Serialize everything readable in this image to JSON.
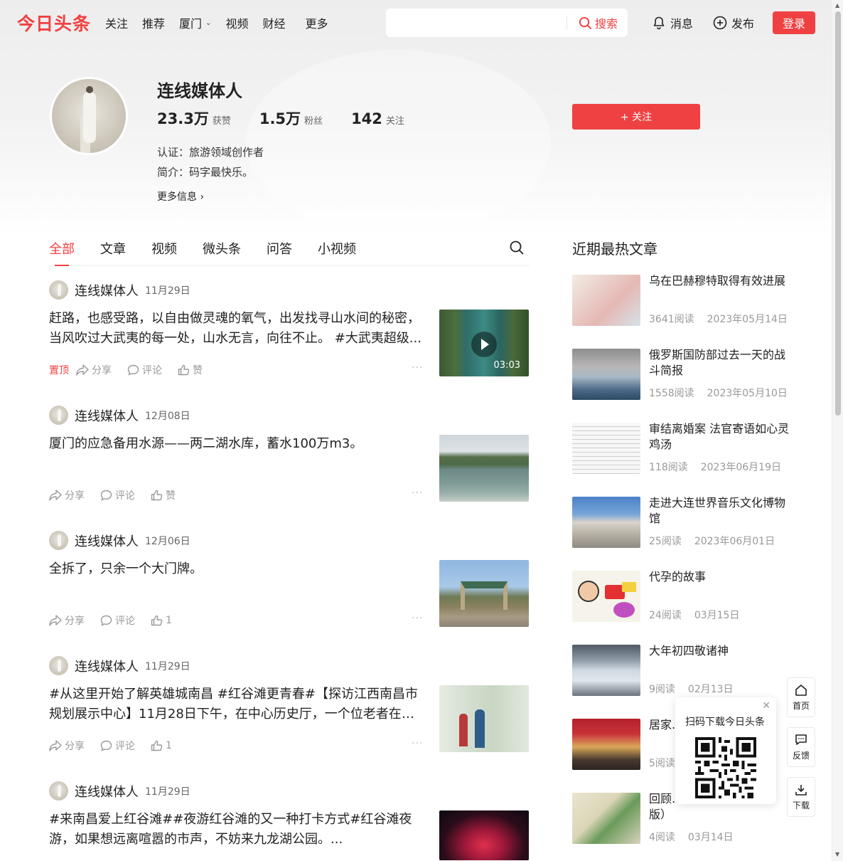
{
  "header": {
    "logo": "今日头条",
    "nav": [
      "关注",
      "推荐",
      "厦门",
      "视频",
      "财经",
      "更多"
    ],
    "search_placeholder": "",
    "search_label": "搜索",
    "messages_label": "消息",
    "publish_label": "发布",
    "login_label": "登录"
  },
  "profile": {
    "name": "连线媒体人",
    "likes_value": "23.3万",
    "likes_label": "获赞",
    "fans_value": "1.5万",
    "fans_label": "粉丝",
    "following_value": "142",
    "following_label": "关注",
    "certification": "认证：旅游领域创作者",
    "intro": "简介：码字最快乐。",
    "more_info": "更多信息",
    "follow_label": "+ 关注"
  },
  "tabs": [
    "全部",
    "文章",
    "视频",
    "微头条",
    "问答",
    "小视频"
  ],
  "feed": [
    {
      "author": "连线媒体人",
      "date": "11月29日",
      "title": "赶路，也感受路，以自由做灵魂的氧气，出发找寻山水间的秘密，当风吹过大武夷的每一处，山水无言，向往不止。 #大武夷超级...",
      "pinned": "置顶",
      "share": "分享",
      "comment": "评论",
      "like": "赞",
      "duration": "03:03"
    },
    {
      "author": "连线媒体人",
      "date": "12月08日",
      "title": "厦门的应急备用水源——两二湖水库，蓄水100万m3。",
      "share": "分享",
      "comment": "评论",
      "like": "赞"
    },
    {
      "author": "连线媒体人",
      "date": "12月06日",
      "title": "全拆了，只余一个大门牌。",
      "share": "分享",
      "comment": "评论",
      "like": "1"
    },
    {
      "author": "连线媒体人",
      "date": "11月29日",
      "title": "#从这里开始了解英雄城南昌 #红谷滩更青春#【探访江西南昌市规划展示中心】11月28日下午，在中心历史厅，一个位老者在家人...",
      "share": "分享",
      "comment": "评论",
      "like": "1"
    },
    {
      "author": "连线媒体人",
      "date": "11月29日",
      "title": "#来南昌爱上红谷滩##夜游红谷滩的又一种打卡方式#红谷滩夜游，如果想远离喧嚣的市声，不妨来九龙湖公园。..."
    }
  ],
  "sidebar": {
    "title": "近期最热文章",
    "articles": [
      {
        "title": "乌在巴赫穆特取得有效进展",
        "reads": "3641阅读",
        "date": "2023年05月14日"
      },
      {
        "title": "俄罗斯国防部过去一天的战斗简报",
        "reads": "1558阅读",
        "date": "2023年05月10日"
      },
      {
        "title": "审结离婚案 法官寄语如心灵鸡汤",
        "reads": "118阅读",
        "date": "2023年06月19日"
      },
      {
        "title": "走进大连世界音乐文化博物馆",
        "reads": "25阅读",
        "date": "2023年06月01日"
      },
      {
        "title": "代孕的故事",
        "reads": "24阅读",
        "date": "03月15日"
      },
      {
        "title": "大年初四敬诸神",
        "reads": "9阅读",
        "date": "02月13日"
      },
      {
        "title": "居家…企业…",
        "reads": "5阅读",
        "date": ""
      },
      {
        "title": "回顾…会曝光名单（完整版）",
        "reads": "4阅读",
        "date": "03月14日"
      }
    ]
  },
  "qr_popup": {
    "text": "扫码下载今日头条"
  },
  "tools": {
    "home": "首页",
    "feedback": "反馈",
    "download": "下载"
  },
  "colors": {
    "brand": "#f04142"
  }
}
